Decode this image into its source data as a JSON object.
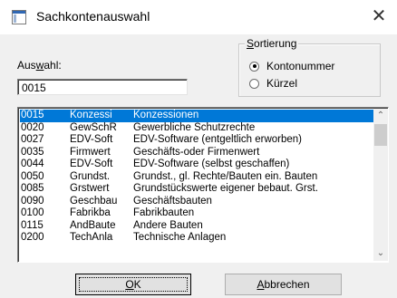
{
  "window": {
    "title": "Sachkontenauswahl",
    "close_glyph": "✕",
    "app_icon": "window-icon"
  },
  "auswahl": {
    "label_prefix": "Aus",
    "label_mnemonic": "w",
    "label_suffix": "ahl:",
    "value": "0015"
  },
  "sortierung": {
    "label_mnemonic": "S",
    "label_rest": "ortierung",
    "options": [
      {
        "label": "Kontonummer",
        "selected": true
      },
      {
        "label": "Kürzel",
        "selected": false
      }
    ]
  },
  "list": {
    "rows": [
      {
        "nr": "0015",
        "kurz": "Konzessi",
        "name": "Konzessionen",
        "selected": true
      },
      {
        "nr": "0020",
        "kurz": "GewSchR",
        "name": "Gewerbliche Schutzrechte"
      },
      {
        "nr": "0027",
        "kurz": "EDV-Soft",
        "name": "EDV-Software (entgeltlich erworben)"
      },
      {
        "nr": "0035",
        "kurz": "Firmwert",
        "name": "Geschäfts-oder Firmenwert"
      },
      {
        "nr": "0044",
        "kurz": "EDV-Soft",
        "name": "EDV-Software (selbst geschaffen)"
      },
      {
        "nr": "0050",
        "kurz": "Grundst.",
        "name": "Grundst., gl. Rechte/Bauten ein. Bauten"
      },
      {
        "nr": "0085",
        "kurz": "Grstwert",
        "name": "Grundstückswerte eigener bebaut. Grst."
      },
      {
        "nr": "0090",
        "kurz": "Geschbau",
        "name": "Geschäftsbauten"
      },
      {
        "nr": "0100",
        "kurz": "Fabrikba",
        "name": "Fabrikbauten"
      },
      {
        "nr": "0115",
        "kurz": "AndBaute",
        "name": "Andere Bauten"
      },
      {
        "nr": "0200",
        "kurz": "TechAnla",
        "name": "Technische Anlagen"
      }
    ],
    "scroll_up": "⌃",
    "scroll_down": "⌄"
  },
  "buttons": {
    "ok_mnemonic": "O",
    "ok_rest": "K",
    "cancel_mnemonic": "A",
    "cancel_rest": "bbrechen"
  }
}
